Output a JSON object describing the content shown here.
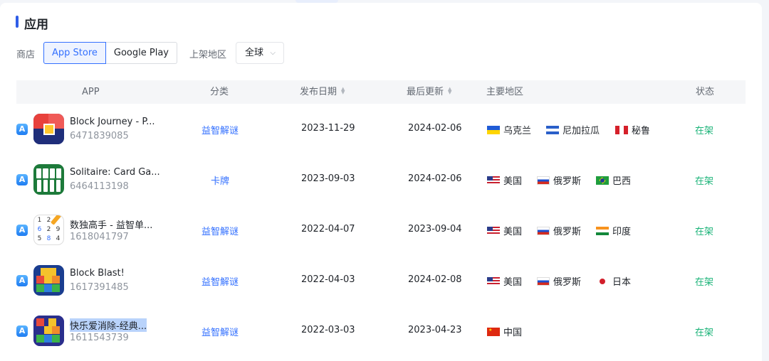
{
  "section": {
    "title": "应用"
  },
  "filters": {
    "store_label": "商店",
    "stores": [
      "App Store",
      "Google Play"
    ],
    "region_label": "上架地区",
    "region_value": "全球"
  },
  "table": {
    "headers": [
      "APP",
      "分类",
      "发布日期",
      "最后更新",
      "主要地区",
      "状态"
    ],
    "rows": [
      {
        "name": "Block Journey - P...",
        "id": "6471839085",
        "category": "益智解谜",
        "release": "2023-11-29",
        "updated": "2024-02-06",
        "regions": [
          "乌克兰",
          "尼加拉瓜",
          "秘鲁"
        ],
        "status": "在架"
      },
      {
        "name": "Solitaire: Card Ga...",
        "id": "6464113198",
        "category": "卡牌",
        "release": "2023-09-03",
        "updated": "2024-02-06",
        "regions": [
          "美国",
          "俄罗斯",
          "巴西"
        ],
        "status": "在架"
      },
      {
        "name": "数独高手 - 益智单...",
        "id": "1618041797",
        "category": "益智解谜",
        "release": "2022-04-07",
        "updated": "2023-09-04",
        "regions": [
          "美国",
          "俄罗斯",
          "印度"
        ],
        "status": "在架"
      },
      {
        "name": "Block Blast!",
        "id": "1617391485",
        "category": "益智解谜",
        "release": "2022-04-03",
        "updated": "2024-02-08",
        "regions": [
          "美国",
          "俄罗斯",
          "日本"
        ],
        "status": "在架"
      },
      {
        "name": "快乐爱消除-经典...",
        "id": "1611543739",
        "category": "益智解谜",
        "release": "2022-03-03",
        "updated": "2023-04-23",
        "regions": [
          "中国"
        ],
        "status": "在架"
      }
    ]
  },
  "colors": {
    "accent": "#3370ff",
    "status_green": "#1ab378",
    "title_bar": "#2f5de7"
  }
}
